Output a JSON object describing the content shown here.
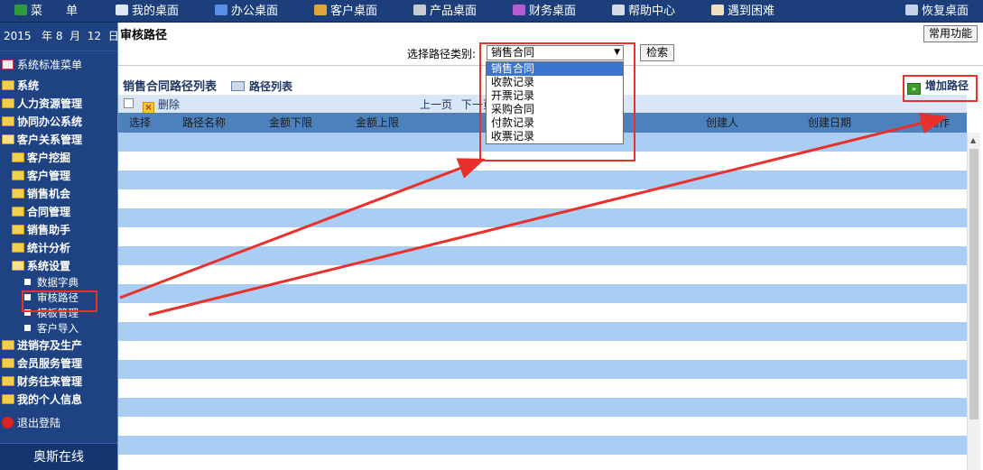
{
  "topbar": {
    "items": [
      {
        "label": "菜　　单",
        "icon": "menu-arrow-icon",
        "color": "#2e9b3f"
      },
      {
        "label": "我的桌面",
        "icon": "desktop-icon",
        "color": "#dfe8f5"
      },
      {
        "label": "办公桌面",
        "icon": "bar-chart-icon",
        "color": "#5a8fe8"
      },
      {
        "label": "客户桌面",
        "icon": "users-icon",
        "color": "#e3a43a"
      },
      {
        "label": "产品桌面",
        "icon": "cart-icon",
        "color": "#c7cbd3"
      },
      {
        "label": "财务桌面",
        "icon": "line-chart-icon",
        "color": "#b65cd0"
      },
      {
        "label": "帮助中心",
        "icon": "book-icon",
        "color": "#d5dce8"
      },
      {
        "label": "遇到困难",
        "icon": "penguin-icon",
        "color": "#f0e0c0"
      },
      {
        "label": "恢复桌面",
        "icon": "restore-icon",
        "color": "#c4d3ea"
      }
    ]
  },
  "date": {
    "year": "2015",
    "year_unit": "年",
    "month": "8",
    "month_unit": "月",
    "day": "12",
    "day_unit": "日"
  },
  "sidebar": {
    "home": "系统标准菜单",
    "items": [
      {
        "label": "系统"
      },
      {
        "label": "人力资源管理"
      },
      {
        "label": "协同办公系统"
      },
      {
        "label": "客户关系管理"
      }
    ],
    "crm_children": [
      {
        "label": "客户挖掘"
      },
      {
        "label": "客户管理"
      },
      {
        "label": "销售机会"
      },
      {
        "label": "合同管理"
      },
      {
        "label": "销售助手"
      },
      {
        "label": "统计分析"
      },
      {
        "label": "系统设置"
      }
    ],
    "settings_children": [
      {
        "label": "数据字典"
      },
      {
        "label": "审核路径"
      },
      {
        "label": "模板管理"
      },
      {
        "label": "客户导入"
      }
    ],
    "more_items": [
      {
        "label": "进销存及生产"
      },
      {
        "label": "会员服务管理"
      },
      {
        "label": "财务往来管理"
      },
      {
        "label": "我的个人信息"
      }
    ],
    "logout": "退出登陆",
    "brand": "奥斯在线"
  },
  "main": {
    "title": "审核路径",
    "common_functions": "常用功能",
    "filter_label": "选择路径类别:",
    "select_value": "销售合同",
    "select_options": [
      "销售合同",
      "收款记录",
      "开票记录",
      "采购合同",
      "付款记录",
      "收票记录"
    ],
    "search_button": "检索",
    "list_title": "销售合同路径列表",
    "list_link": "路径列表",
    "add_button": "增加路径",
    "delete_button": "删除",
    "pager_prev": "上一页",
    "pager_next": "下一页",
    "columns": [
      "选择",
      "路径名称",
      "金额下限",
      "金额上限",
      "创建人",
      "创建日期",
      "操作"
    ]
  },
  "colors": {
    "topbar": "#1c3f7c",
    "sidebar": "#1e4282",
    "header_row": "#4d81be",
    "stripe": "#a9cdf3",
    "annotation": "#e8302c"
  }
}
